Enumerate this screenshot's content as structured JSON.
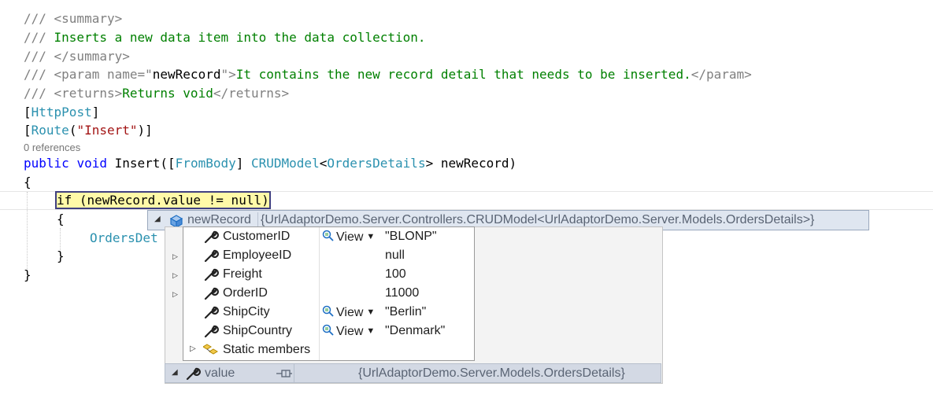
{
  "code": {
    "l1": {
      "a": "/// ",
      "b": "<summary>"
    },
    "l2": {
      "a": "/// ",
      "b": "Inserts a new data item into the data collection."
    },
    "l3": {
      "a": "/// ",
      "b": "</summary>"
    },
    "l4": {
      "a": "/// ",
      "b": "<param name=\"",
      "c": "newRecord",
      "d": "\">",
      "e": "It contains the new record detail that needs to be inserted.",
      "f": "</param>"
    },
    "l5": {
      "a": "/// ",
      "b": "<returns>",
      "c": "Returns void",
      "d": "</returns>"
    },
    "l6": {
      "a": "[",
      "b": "HttpPost",
      "c": "]"
    },
    "l7": {
      "a": "[",
      "b": "Route",
      "c": "(",
      "d": "\"Insert\"",
      "e": ")]"
    },
    "references": "0 references",
    "l8": {
      "a": "public",
      "b": " ",
      "c": "void",
      "d": " Insert([",
      "e": "FromBody",
      "f": "] ",
      "g": "CRUDModel",
      "h": "<",
      "i": "OrdersDetails",
      "j": "> newRecord)"
    },
    "l9": "{",
    "l10": "if (newRecord.value != null)",
    "l11": "{",
    "l12": "OrdersDet",
    "l13": "}",
    "l14": "}"
  },
  "datatip": {
    "root": {
      "name": "newRecord",
      "value": "{UrlAdaptorDemo.Server.Controllers.CRUDModel<UrlAdaptorDemo.Server.Models.OrdersDetails>}",
      "icon": "object-icon"
    },
    "properties": [
      {
        "name": "CustomerID",
        "viewer": "View",
        "value": "\"BLONP\""
      },
      {
        "name": "EmployeeID",
        "viewer": "",
        "value": "null"
      },
      {
        "name": "Freight",
        "viewer": "",
        "value": "100"
      },
      {
        "name": "OrderID",
        "viewer": "",
        "value": "11000"
      },
      {
        "name": "ShipCity",
        "viewer": "View",
        "value": "\"Berlin\""
      },
      {
        "name": "ShipCountry",
        "viewer": "View",
        "value": "\"Denmark\""
      },
      {
        "name": "Static members",
        "viewer": "",
        "value": ""
      }
    ],
    "value_row": {
      "name": "value",
      "value": "{UrlAdaptorDemo.Server.Models.OrdersDetails}"
    }
  },
  "colors": {
    "comment": "#808080",
    "comment_text": "#008000",
    "keyword": "#0000ff",
    "type": "#2b91af",
    "string": "#a31515",
    "highlight": "#fff9a8"
  }
}
